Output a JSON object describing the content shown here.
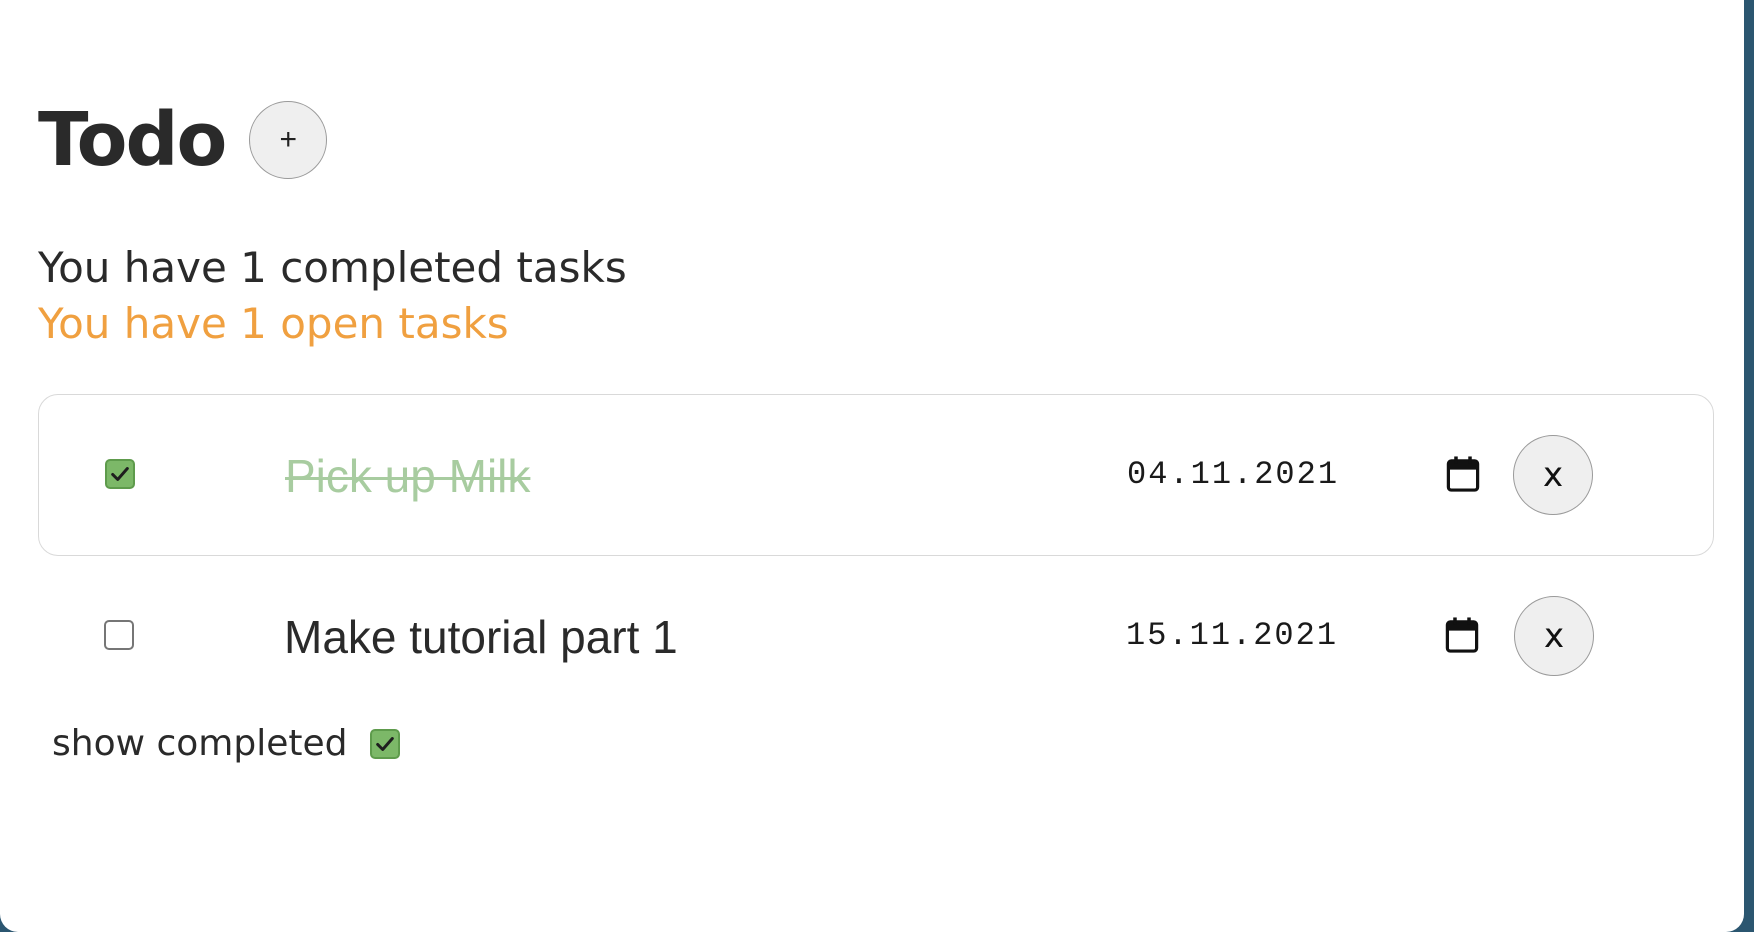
{
  "header": {
    "title": "Todo",
    "add_label": "+"
  },
  "summary": {
    "completed_text": "You have 1 completed tasks",
    "open_text": "You have 1 open tasks"
  },
  "tasks": [
    {
      "text": "Pick up Milk",
      "date": "04.11.2021",
      "completed": true,
      "delete_label": "x"
    },
    {
      "text": "Make tutorial part 1",
      "date": "15.11.2021",
      "completed": false,
      "delete_label": "x"
    }
  ],
  "footer": {
    "show_completed_label": "show completed",
    "show_completed_checked": true
  },
  "colors": {
    "accent_open": "#f0a040",
    "check_green": "#7cb868",
    "done_text": "#a8cca0",
    "outer_background": "#2b5670"
  },
  "icons": {
    "calendar": "calendar-icon",
    "check": "checkmark-icon"
  }
}
